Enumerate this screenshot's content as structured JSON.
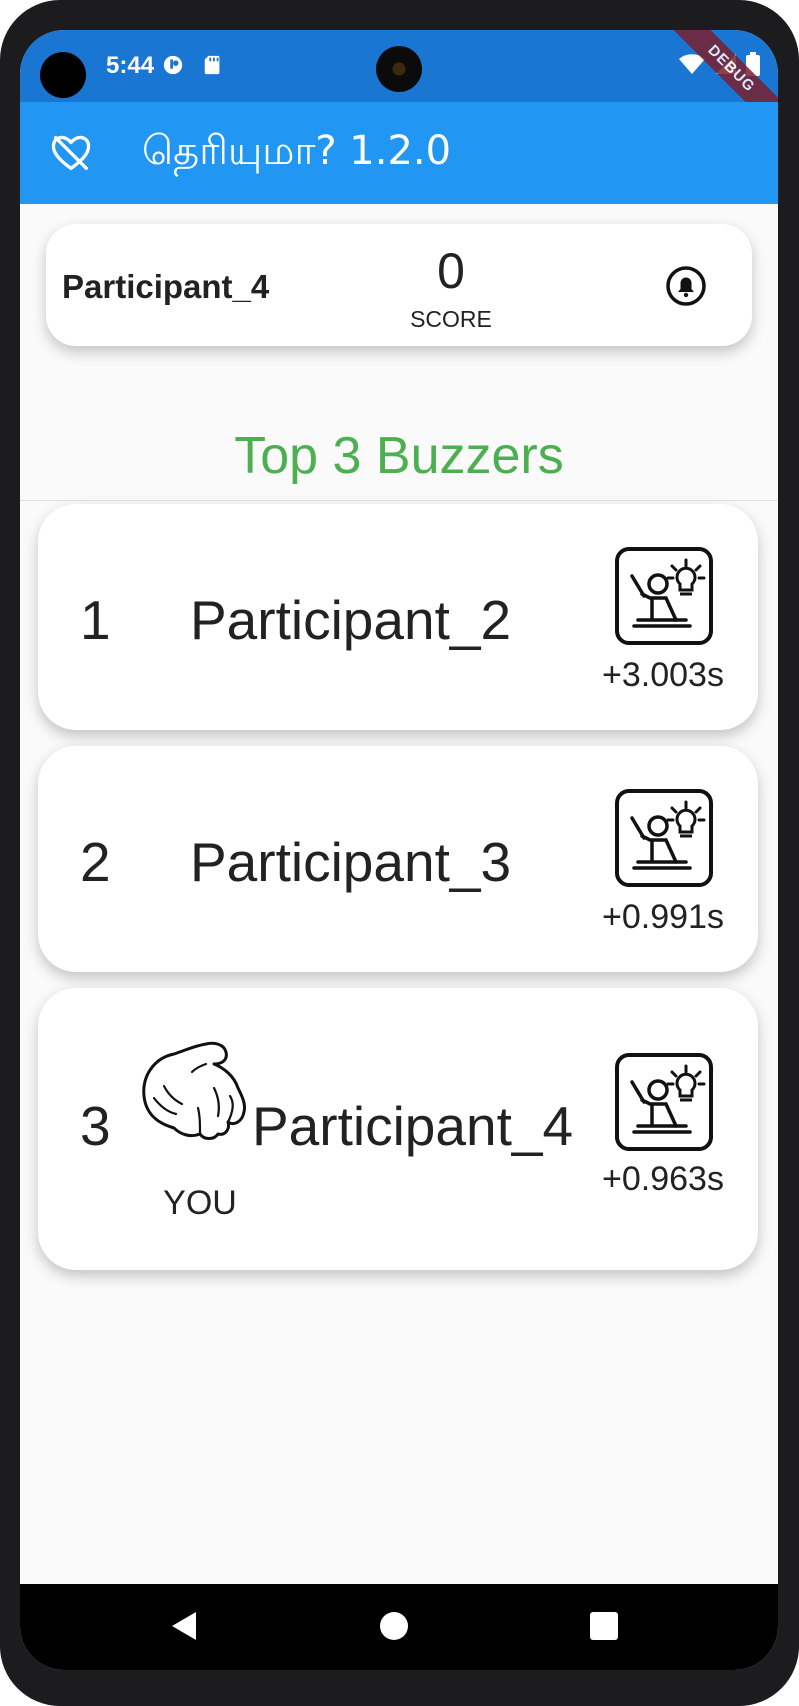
{
  "status_bar": {
    "time": "5:44",
    "debug_banner": "DEBUG"
  },
  "app_bar": {
    "title": "தெரியுமா? 1.2.0"
  },
  "player": {
    "name": "Participant_4",
    "score": "0",
    "score_label": "SCORE"
  },
  "section_title": "Top 3 Buzzers",
  "buzzers": [
    {
      "rank": "1",
      "name": "Participant_2",
      "time": "+3.003s",
      "is_you": false
    },
    {
      "rank": "2",
      "name": "Participant_3",
      "time": "+0.991s",
      "is_you": false
    },
    {
      "rank": "3",
      "name": "Participant_4",
      "time": "+0.963s",
      "is_you": true
    }
  ],
  "you_label": "YOU",
  "colors": {
    "status_bar": "#1976d2",
    "app_bar": "#2196f3",
    "section_title": "#4caf50"
  },
  "icons": {
    "app_bar": "heart-off-icon",
    "player_card": "bell-icon",
    "buzzer": "raise-hand-idea-icon",
    "you_marker": "pointing-hand-icon",
    "nav": [
      "back-icon",
      "home-icon",
      "recents-icon"
    ]
  }
}
